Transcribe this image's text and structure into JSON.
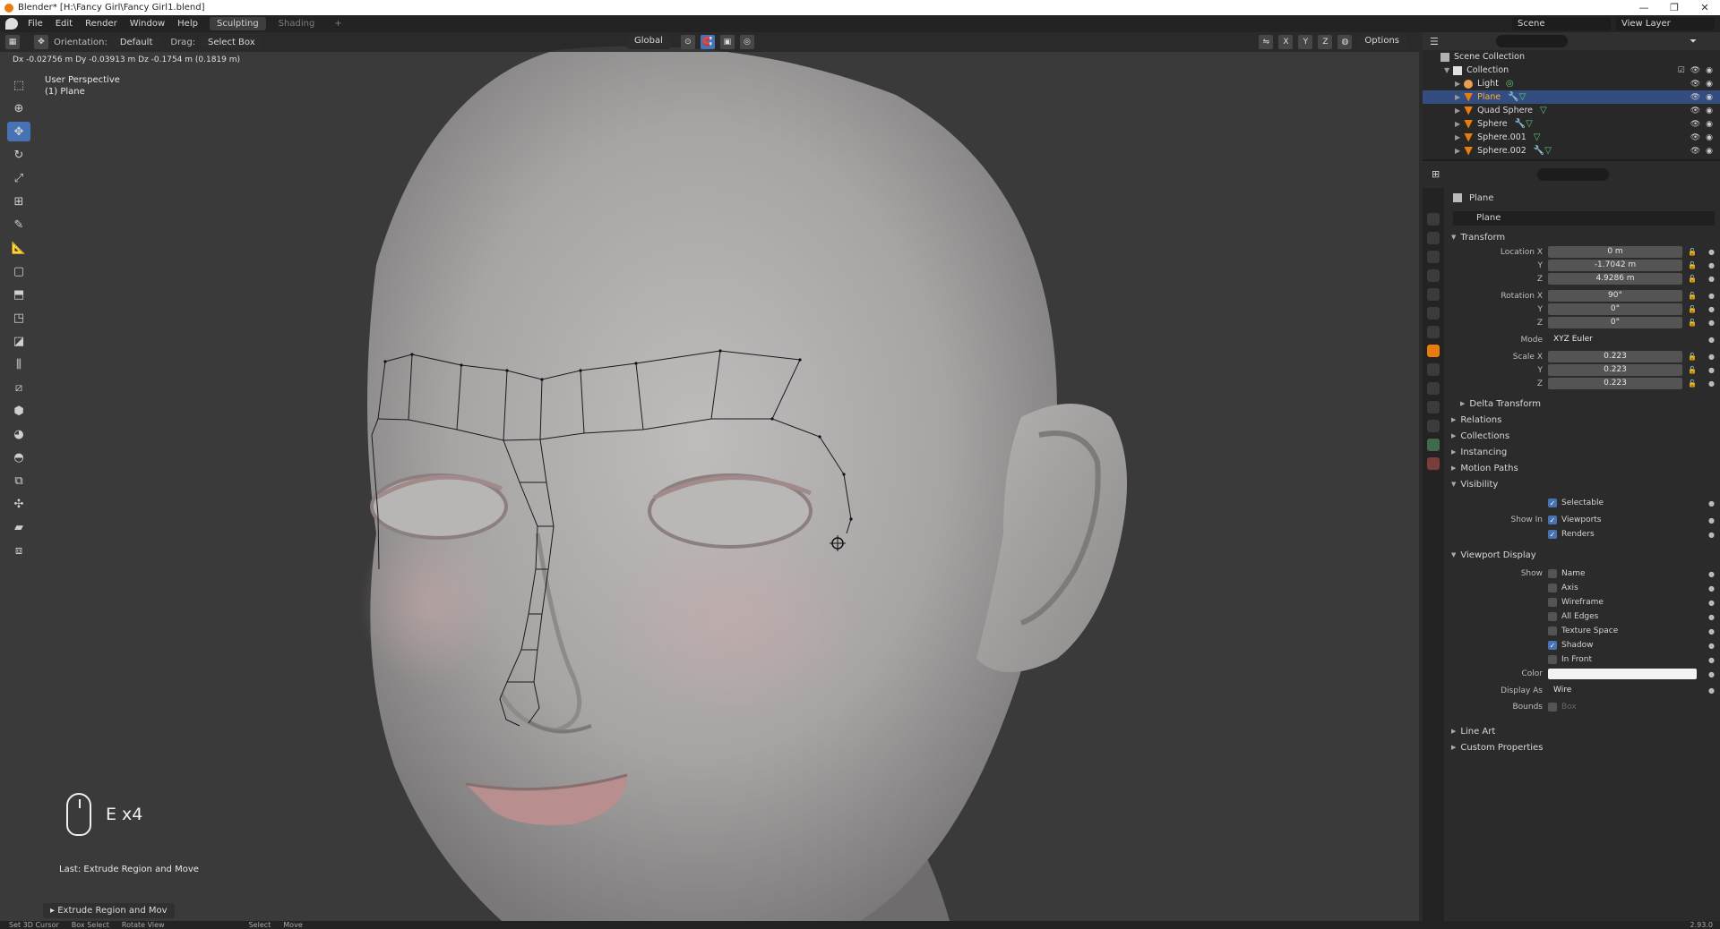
{
  "window": {
    "title": "Blender* [H:\\Fancy Girl\\Fancy Girl1.blend]",
    "controls": [
      "—",
      "❐",
      "✕"
    ]
  },
  "menubar": {
    "items": [
      "File",
      "Edit",
      "Render",
      "Window",
      "Help"
    ],
    "workspaces": [
      {
        "label": "Sculpting",
        "active": true
      },
      {
        "label": "Shading",
        "active": false
      }
    ],
    "add_tab": "+",
    "scene": "Scene",
    "view_layer": "View Layer"
  },
  "viewport_header": {
    "orientation_label": "Orientation:",
    "orientation_value": "Default",
    "drag_label": "Drag:",
    "drag_value": "Select Box",
    "transform_orientation": "Global",
    "axes": [
      "X",
      "Y",
      "Z"
    ],
    "options": "Options"
  },
  "viewport": {
    "op_info": "Dx -0.02756 m  Dy -0.03913 m  Dz -0.1754 m (0.1819 m)",
    "perspective": "User Perspective",
    "active_object": "(1) Plane",
    "key_hint": "E x4",
    "last_op": "Last: Extrude Region and Move",
    "redo_panel": "Extrude Region and Mov"
  },
  "statusbar": {
    "items": [
      "Set 3D Cursor",
      "Box Select",
      "Rotate View",
      "Select",
      "Move"
    ],
    "version": "2.93.0"
  },
  "outliner": {
    "root": "Scene Collection",
    "collection": "Collection",
    "objects": [
      {
        "name": "Light",
        "type": "light",
        "selected": false
      },
      {
        "name": "Plane",
        "type": "mesh",
        "selected": true
      },
      {
        "name": "Quad Sphere",
        "type": "mesh",
        "selected": false
      },
      {
        "name": "Sphere",
        "type": "mesh",
        "selected": false
      },
      {
        "name": "Sphere.001",
        "type": "mesh",
        "selected": false
      },
      {
        "name": "Sphere.002",
        "type": "mesh",
        "selected": false
      }
    ]
  },
  "properties": {
    "context_object": "Plane",
    "object_name": "Plane",
    "transform": {
      "title": "Transform",
      "location_label": "Location X",
      "location": [
        "0 m",
        "-1.7042 m",
        "4.9286 m"
      ],
      "rotation_label": "Rotation X",
      "rotation": [
        "90°",
        "0°",
        "0°"
      ],
      "mode_label": "Mode",
      "mode": "XYZ Euler",
      "scale_label": "Scale X",
      "scale": [
        "0.223",
        "0.223",
        "0.223"
      ],
      "axis_y": "Y",
      "axis_z": "Z"
    },
    "collapsed_panels_1": [
      "Delta Transform"
    ],
    "collapsed_panels_2": [
      "Relations",
      "Collections",
      "Instancing",
      "Motion Paths"
    ],
    "visibility": {
      "title": "Visibility",
      "selectable": "Selectable",
      "show_in_label": "Show In",
      "viewports": "Viewports",
      "renders": "Renders"
    },
    "viewport_display": {
      "title": "Viewport Display",
      "show_label": "Show",
      "options": [
        {
          "label": "Name",
          "checked": false
        },
        {
          "label": "Axis",
          "checked": false
        },
        {
          "label": "Wireframe",
          "checked": false
        },
        {
          "label": "All Edges",
          "checked": false
        },
        {
          "label": "Texture Space",
          "checked": false
        },
        {
          "label": "Shadow",
          "checked": true
        },
        {
          "label": "In Front",
          "checked": false
        }
      ],
      "color_label": "Color",
      "color": "#f2f2f2",
      "display_as_label": "Display As",
      "display_as": "Wire",
      "bounds_label": "Bounds",
      "bounds": "Box"
    },
    "collapsed_panels_3": [
      "Line Art",
      "Custom Properties"
    ]
  },
  "colors": {
    "accent": "#4772b3",
    "selected_row": "#334d80",
    "active_name": "#ffaf29",
    "blender_orange": "#e87d0d"
  }
}
